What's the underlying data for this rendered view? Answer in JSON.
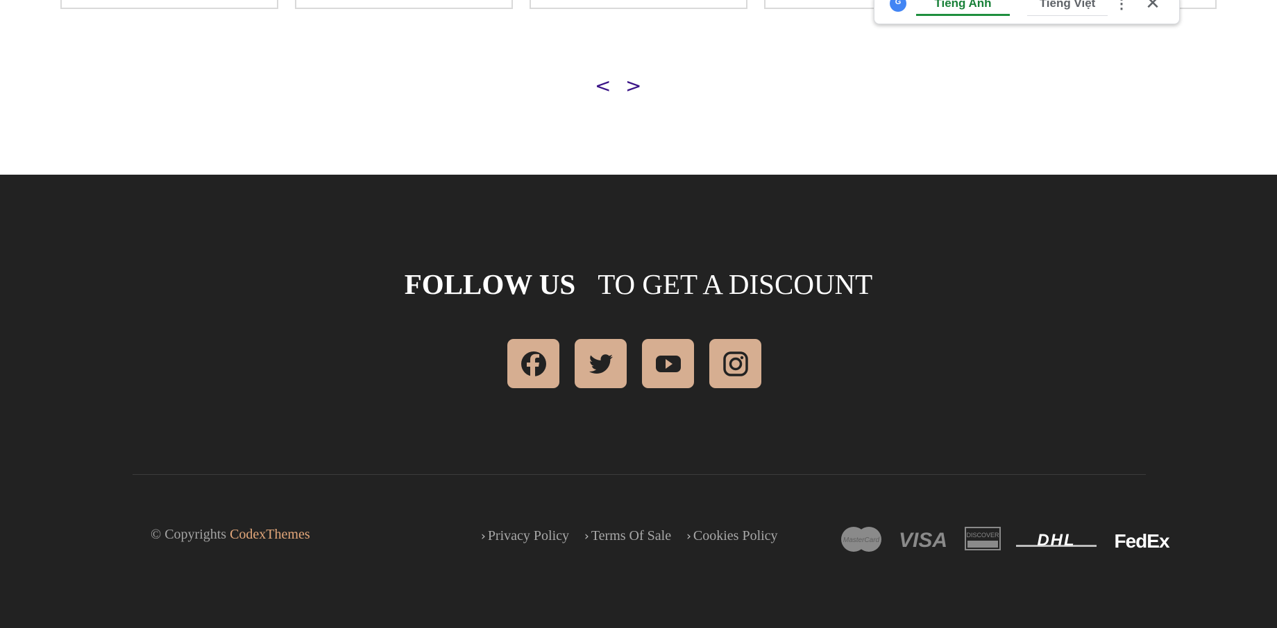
{
  "translate_bar": {
    "logo_label": "G",
    "tabs": [
      "Tiếng Anh",
      "Tiếng Việt"
    ],
    "active_tab": "Tiếng Anh",
    "more_icon": "⋮",
    "close_icon": "✕"
  },
  "pager": {
    "prev": "<",
    "next": ">"
  },
  "footer": {
    "headline_strong": "FOLLOW US",
    "headline_light": "TO GET A DISCOUNT",
    "socials": [
      {
        "name": "facebook-icon"
      },
      {
        "name": "twitter-icon"
      },
      {
        "name": "youtube-icon"
      },
      {
        "name": "instagram-icon"
      }
    ],
    "copyright_prefix": "© Copyrights",
    "copyright_brand": "CodexThemes",
    "links": [
      "Privacy Policy",
      "Terms Of Sale",
      "Cookies Policy"
    ],
    "payments": [
      "MasterCard",
      "VISA",
      "DISCOVER",
      "DHL",
      "FedEx"
    ]
  },
  "colors": {
    "footer_bg": "#222222",
    "social_bg": "#d6ae91",
    "brand_accent": "#e3a77a",
    "pager_arrow": "#3b1487",
    "translate_active": "#188038"
  }
}
